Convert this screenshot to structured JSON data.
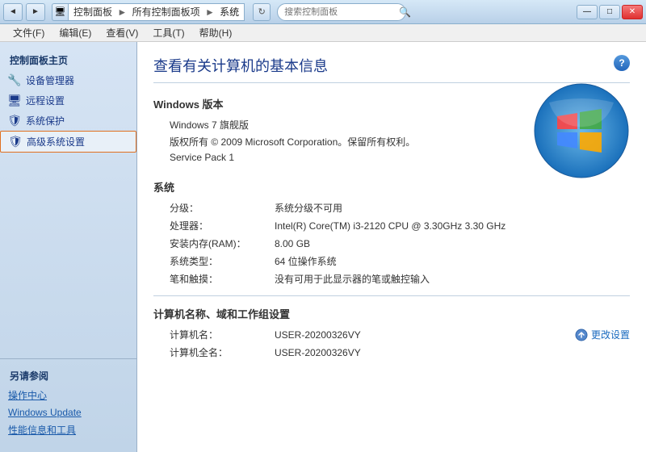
{
  "titlebar": {
    "back_btn": "◄",
    "forward_btn": "►",
    "address": {
      "icon": "🖥",
      "path_part1": "控制面板",
      "path_sep1": "►",
      "path_part2": "所有控制面板项",
      "path_sep2": "►",
      "path_part3": "系统"
    },
    "refresh_btn": "↻",
    "search_placeholder": "搜索控制面板",
    "min_btn": "—",
    "max_btn": "□",
    "close_btn": "✕"
  },
  "menubar": {
    "items": [
      {
        "label": "文件(F)"
      },
      {
        "label": "编辑(E)"
      },
      {
        "label": "查看(V)"
      },
      {
        "label": "工具(T)"
      },
      {
        "label": "帮助(H)"
      }
    ]
  },
  "sidebar": {
    "main_section": "控制面板主页",
    "nav_items": [
      {
        "id": "device-manager",
        "label": "设备管理器",
        "icon": "🔧"
      },
      {
        "id": "remote-settings",
        "label": "远程设置",
        "icon": "🖥"
      },
      {
        "id": "system-protection",
        "label": "系统保护",
        "icon": "🛡"
      },
      {
        "id": "advanced-settings",
        "label": "高级系统设置",
        "icon": "🛡",
        "active": true
      }
    ],
    "also_see_title": "另请参阅",
    "links": [
      {
        "label": "操作中心"
      },
      {
        "label": "Windows Update"
      },
      {
        "label": "性能信息和工具"
      }
    ]
  },
  "content": {
    "page_title": "查看有关计算机的基本信息",
    "help_icon": "?",
    "windows_section_title": "Windows 版本",
    "windows_edition": "Windows 7 旗舰版",
    "copyright": "版权所有 © 2009 Microsoft Corporation。保留所有权利。",
    "service_pack": "Service Pack 1",
    "system_section_title": "系统",
    "system_items": [
      {
        "label": "分级：",
        "value": "系统分级不可用",
        "is_link": true
      },
      {
        "label": "处理器：",
        "value": "Intel(R) Core(TM) i3-2120 CPU @ 3.30GHz   3.30 GHz",
        "is_link": false
      },
      {
        "label": "安装内存(RAM)：",
        "value": "8.00 GB",
        "is_link": false
      },
      {
        "label": "系统类型：",
        "value": "64 位操作系统",
        "is_link": false
      },
      {
        "label": "笔和触摸：",
        "value": "没有可用于此显示器的笔或触控输入",
        "is_link": false
      }
    ],
    "computer_section_title": "计算机名称、域和工作组设置",
    "change_settings_label": "更改设置",
    "computer_items": [
      {
        "label": "计算机名：",
        "value": "USER-20200326VY"
      },
      {
        "label": "计算机全名：",
        "value": "USER-20200326VY"
      }
    ]
  }
}
